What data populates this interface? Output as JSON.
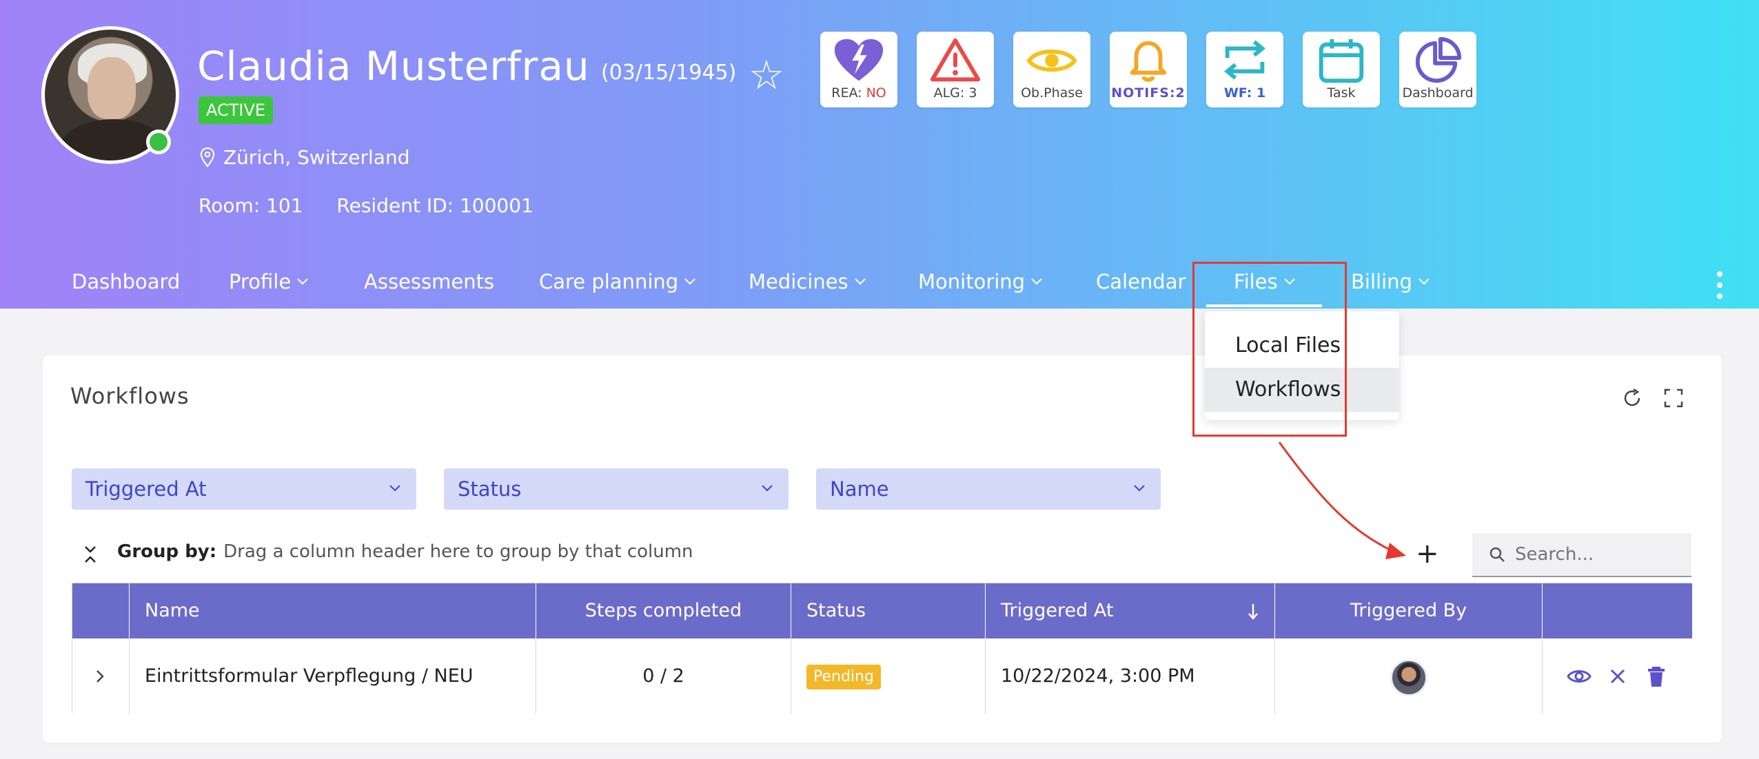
{
  "patient": {
    "name": "Claudia Musterfrau",
    "dob": "(03/15/1945)",
    "status": "ACTIVE",
    "location": "Zürich, Switzerland",
    "room": "Room: 101",
    "resident_id": "Resident ID: 100001"
  },
  "tiles": {
    "rea_prefix": "REA: ",
    "rea_value": "NO",
    "alg": "ALG: 3",
    "ob_phase": "Ob.Phase",
    "notifs": "NOTIFS:2",
    "wf_prefix": "WF: ",
    "wf_value": "1",
    "task": "Task",
    "dashboard": "Dashboard"
  },
  "nav": {
    "dashboard": "Dashboard",
    "profile": "Profile",
    "assessments": "Assessments",
    "care_planning": "Care planning",
    "medicines": "Medicines",
    "monitoring": "Monitoring",
    "calendar": "Calendar",
    "files": "Files",
    "billing": "Billing"
  },
  "files_menu": {
    "local_files": "Local Files",
    "workflows": "Workflows"
  },
  "card": {
    "title": "Workflows",
    "filters": [
      "Triggered At",
      "Status",
      "Name"
    ],
    "group_by_label": "Group by:",
    "group_by_hint": "Drag a column header here to group by that column",
    "search_placeholder": "Search...",
    "add_symbol": "+"
  },
  "table": {
    "columns": [
      "Name",
      "Steps completed",
      "Status",
      "Triggered At",
      "Triggered By"
    ],
    "rows": [
      {
        "name": "Eintrittsformular Verpflegung / NEU",
        "steps": "0 / 2",
        "status": "Pending",
        "triggered_at": "10/22/2024, 3:00 PM"
      }
    ]
  },
  "colors": {
    "accent": "#6b6bc9",
    "filter_bg": "#d5d9f8",
    "active_badge": "#3cc63c",
    "pending_badge": "#f3b829",
    "annotation_red": "#e53a2f"
  }
}
